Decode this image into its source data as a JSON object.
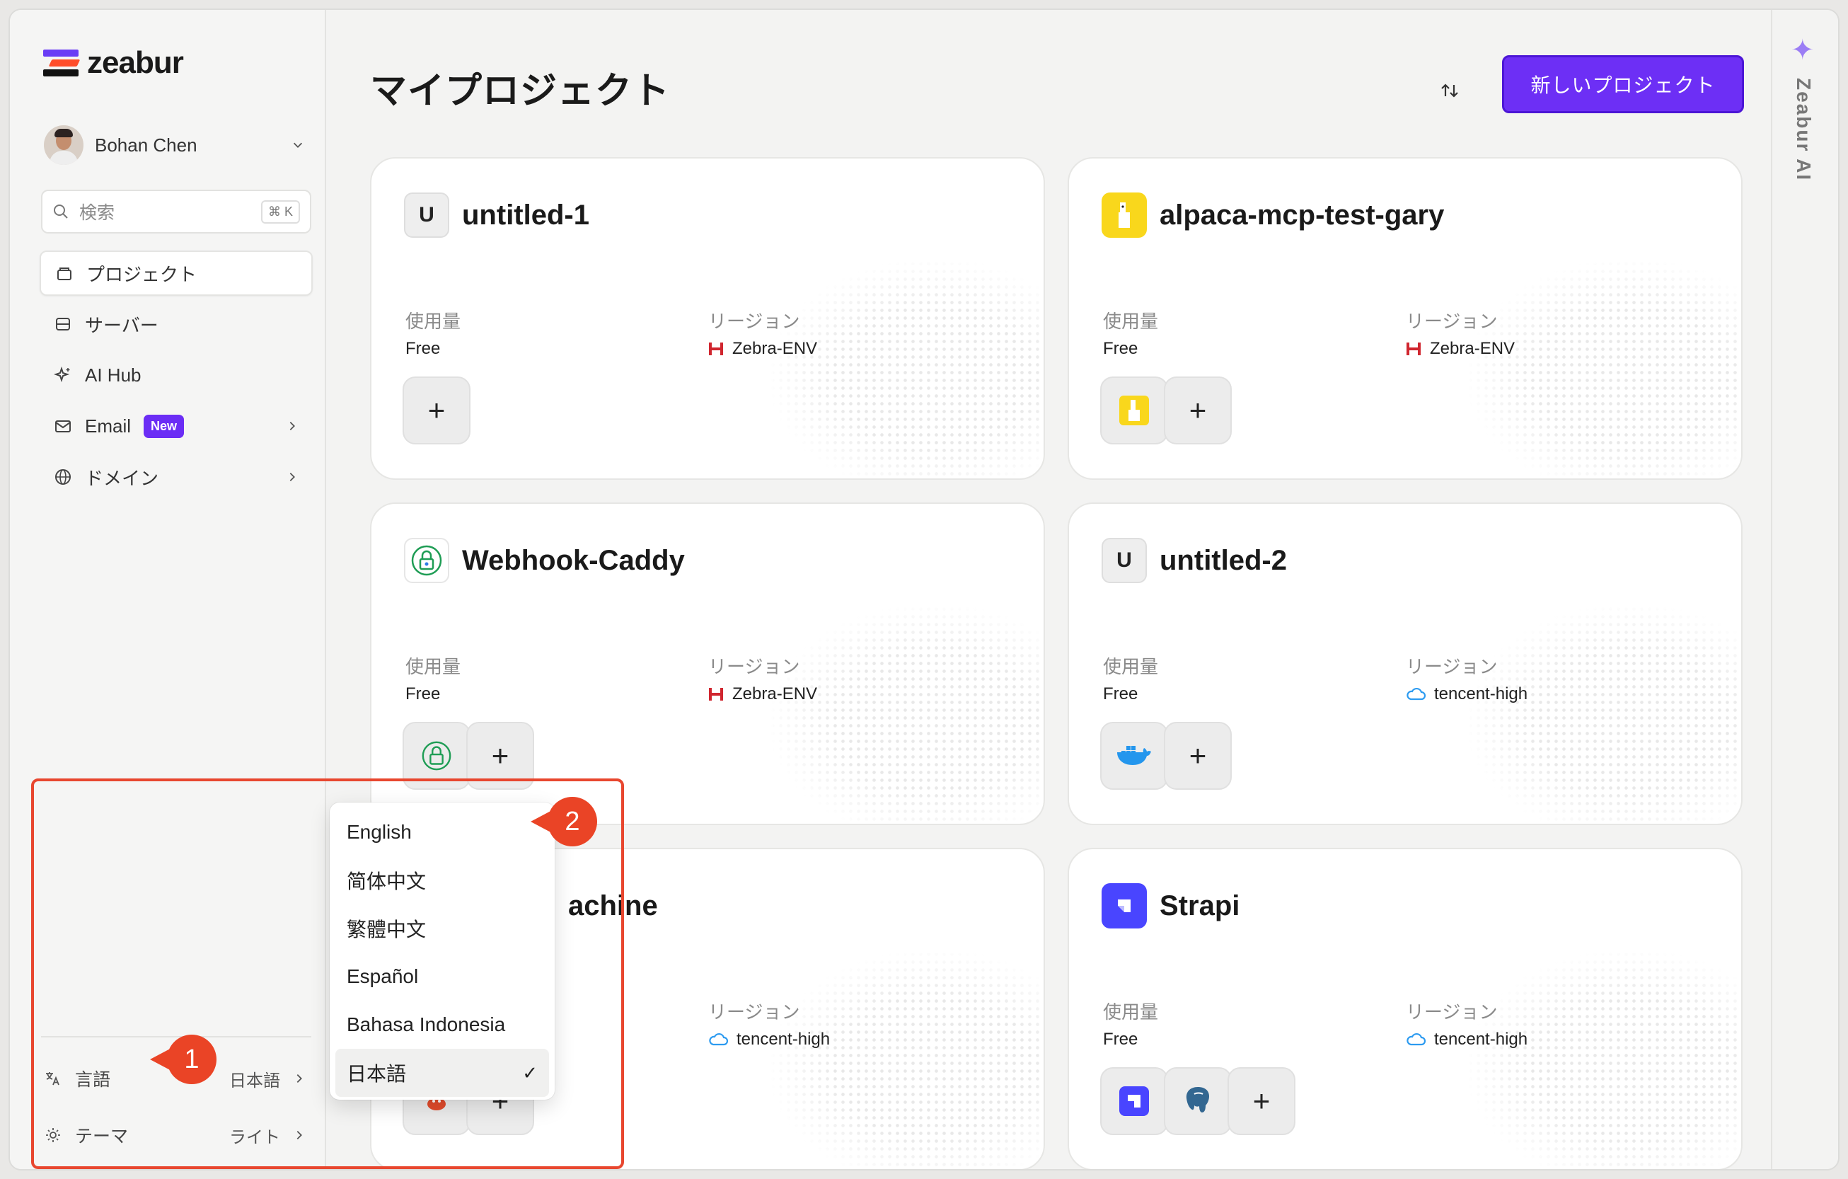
{
  "brand": {
    "name": "zeabur"
  },
  "user": {
    "name": "Bohan Chen"
  },
  "search": {
    "placeholder": "検索",
    "shortcut": "⌘ K"
  },
  "nav": [
    {
      "label": "プロジェクト",
      "icon": "folder-icon",
      "active": true
    },
    {
      "label": "サーバー",
      "icon": "server-icon"
    },
    {
      "label": "AI Hub",
      "icon": "sparkle-icon"
    },
    {
      "label": "Email",
      "icon": "mail-icon",
      "badge": "New"
    },
    {
      "label": "ドメイン",
      "icon": "globe-icon"
    }
  ],
  "settings": {
    "language_label": "言語",
    "language_value": "日本語",
    "theme_label": "テーマ",
    "theme_value": "ライト"
  },
  "main": {
    "title": "マイプロジェクト",
    "new_project_label": "新しいプロジェクト"
  },
  "labels": {
    "usage": "使用量",
    "region": "リージョン"
  },
  "projects": [
    {
      "title": "untitled-1",
      "icon_letter": "U",
      "usage": "Free",
      "region": "Zebra-ENV",
      "region_icon": "zebra-h-icon"
    },
    {
      "title": "alpaca-mcp-test-gary",
      "usage": "Free",
      "region": "Zebra-ENV",
      "region_icon": "zebra-h-icon"
    },
    {
      "title": "Webhook-Caddy",
      "usage": "Free",
      "region": "Zebra-ENV",
      "region_icon": "zebra-h-icon"
    },
    {
      "title": "untitled-2",
      "icon_letter": "U",
      "usage": "Free",
      "region": "tencent-high",
      "region_icon": "cloud-icon"
    },
    {
      "title": "achine",
      "usage": "",
      "region": "tencent-high",
      "region_icon": "cloud-icon"
    },
    {
      "title": "Strapi",
      "usage": "Free",
      "region": "tencent-high",
      "region_icon": "cloud-icon"
    }
  ],
  "rail": {
    "label": "Zeabur AI"
  },
  "language_menu": {
    "options": [
      "English",
      "简体中文",
      "繁體中文",
      "Español",
      "Bahasa Indonesia",
      "日本語"
    ],
    "selected": "日本語"
  },
  "annotations": {
    "step1": "1",
    "step2": "2"
  },
  "colors": {
    "accent": "#6d2ff5",
    "annotation": "#ea4426",
    "zebra": "#d0262f",
    "cloud": "#2d9bf0"
  }
}
